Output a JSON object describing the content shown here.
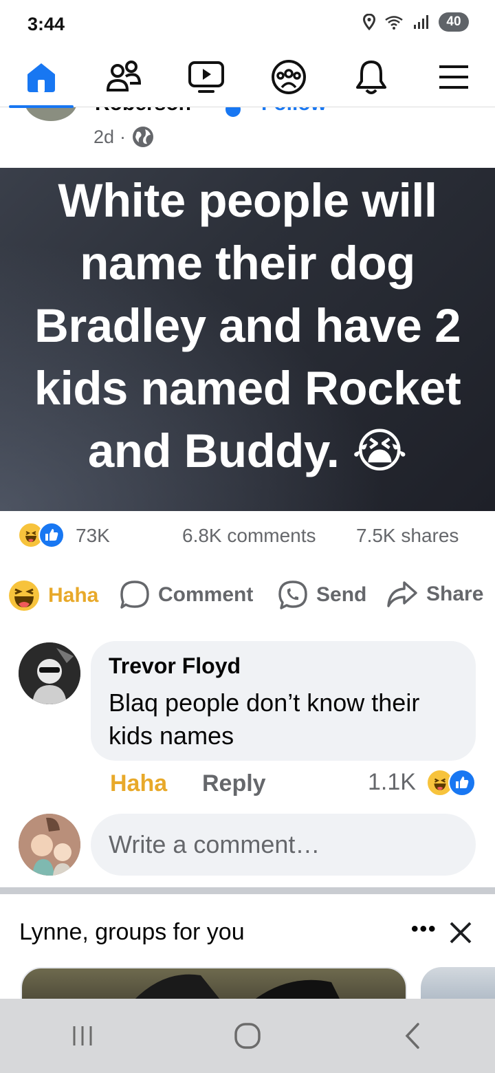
{
  "status_bar": {
    "time": "3:44",
    "battery": "40"
  },
  "top_nav": {
    "items": [
      "home",
      "friends",
      "watch",
      "groups",
      "notifications",
      "menu"
    ],
    "active": "home",
    "accent": "#1877f2"
  },
  "post": {
    "author_name": "Roberson",
    "follow_label": "Follow",
    "time": "2d",
    "time_separator": "·",
    "visibility_icon": "globe-icon",
    "image_text": "White people will name their dog Bradley and have 2 kids named Rocket and Buddy. 😭",
    "image_bg": "#2b2f38"
  },
  "reactions": {
    "icons": [
      "haha-icon",
      "like-icon"
    ],
    "count": "73K",
    "comments": "6.8K comments",
    "shares": "7.5K shares"
  },
  "actions": {
    "haha": "Haha",
    "comment": "Comment",
    "send": "Send",
    "share": "Share"
  },
  "comment": {
    "author": "Trevor Floyd",
    "text": "Blaq people don’t know their kids names",
    "haha_label": "Haha",
    "reply_label": "Reply",
    "reaction_count": "1.1K"
  },
  "write_comment": {
    "placeholder": "Write a comment…"
  },
  "groups_section": {
    "title": "Lynne, groups for you",
    "more": "•••"
  },
  "android_nav": [
    "recents",
    "home",
    "back"
  ]
}
